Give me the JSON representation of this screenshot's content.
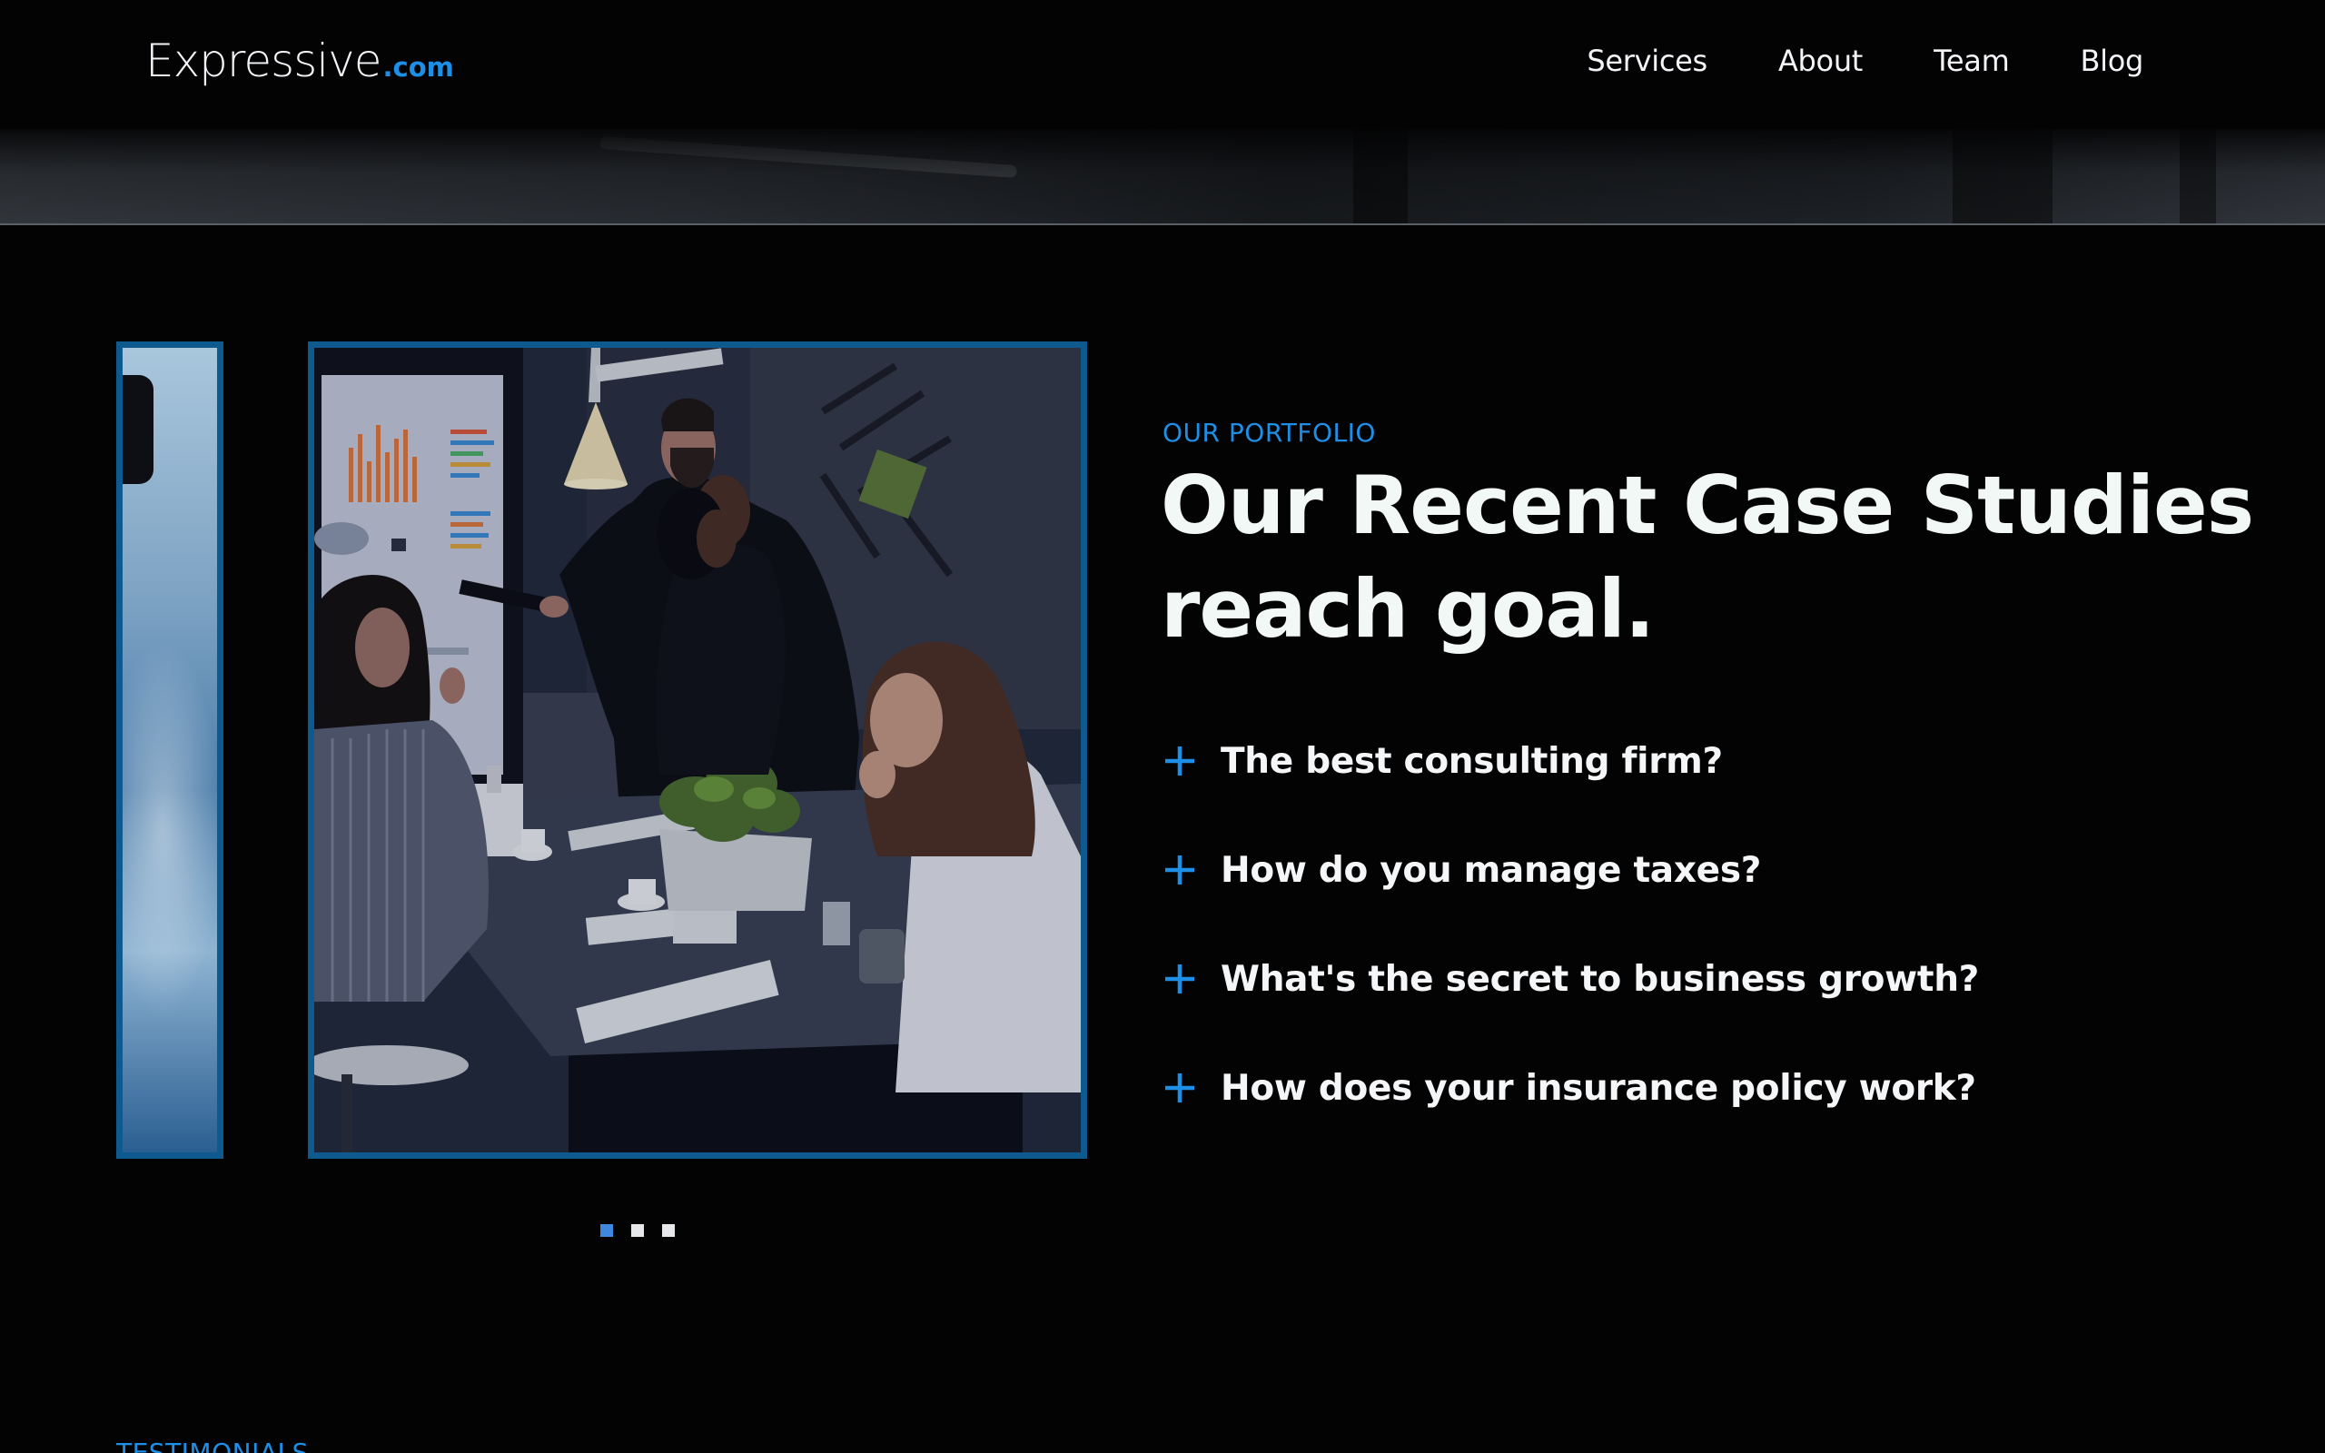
{
  "colors": {
    "background": "#030304",
    "accent": "#1e8fe6",
    "frame": "#0e5a8f",
    "dot_active": "#3f88df",
    "heading": "#f1f8f6"
  },
  "header": {
    "logo_main": "Expressive",
    "logo_suffix": ".com",
    "nav": [
      "Services",
      "About",
      "Team",
      "Blog"
    ]
  },
  "portfolio": {
    "eyebrow": "OUR PORTFOLIO",
    "headline_line1": "Our Recent Case Studies",
    "headline_line2": "reach goal.",
    "faq_icon": "plus-icon",
    "faqs": [
      "The best consulting firm?",
      "How do you manage taxes?",
      "What's the secret to business growth?",
      "How does your insurance policy work?"
    ],
    "carousel": {
      "slide_count": 3,
      "active_index": 0
    }
  },
  "next_section": {
    "eyebrow": "TESTIMONIALS"
  }
}
